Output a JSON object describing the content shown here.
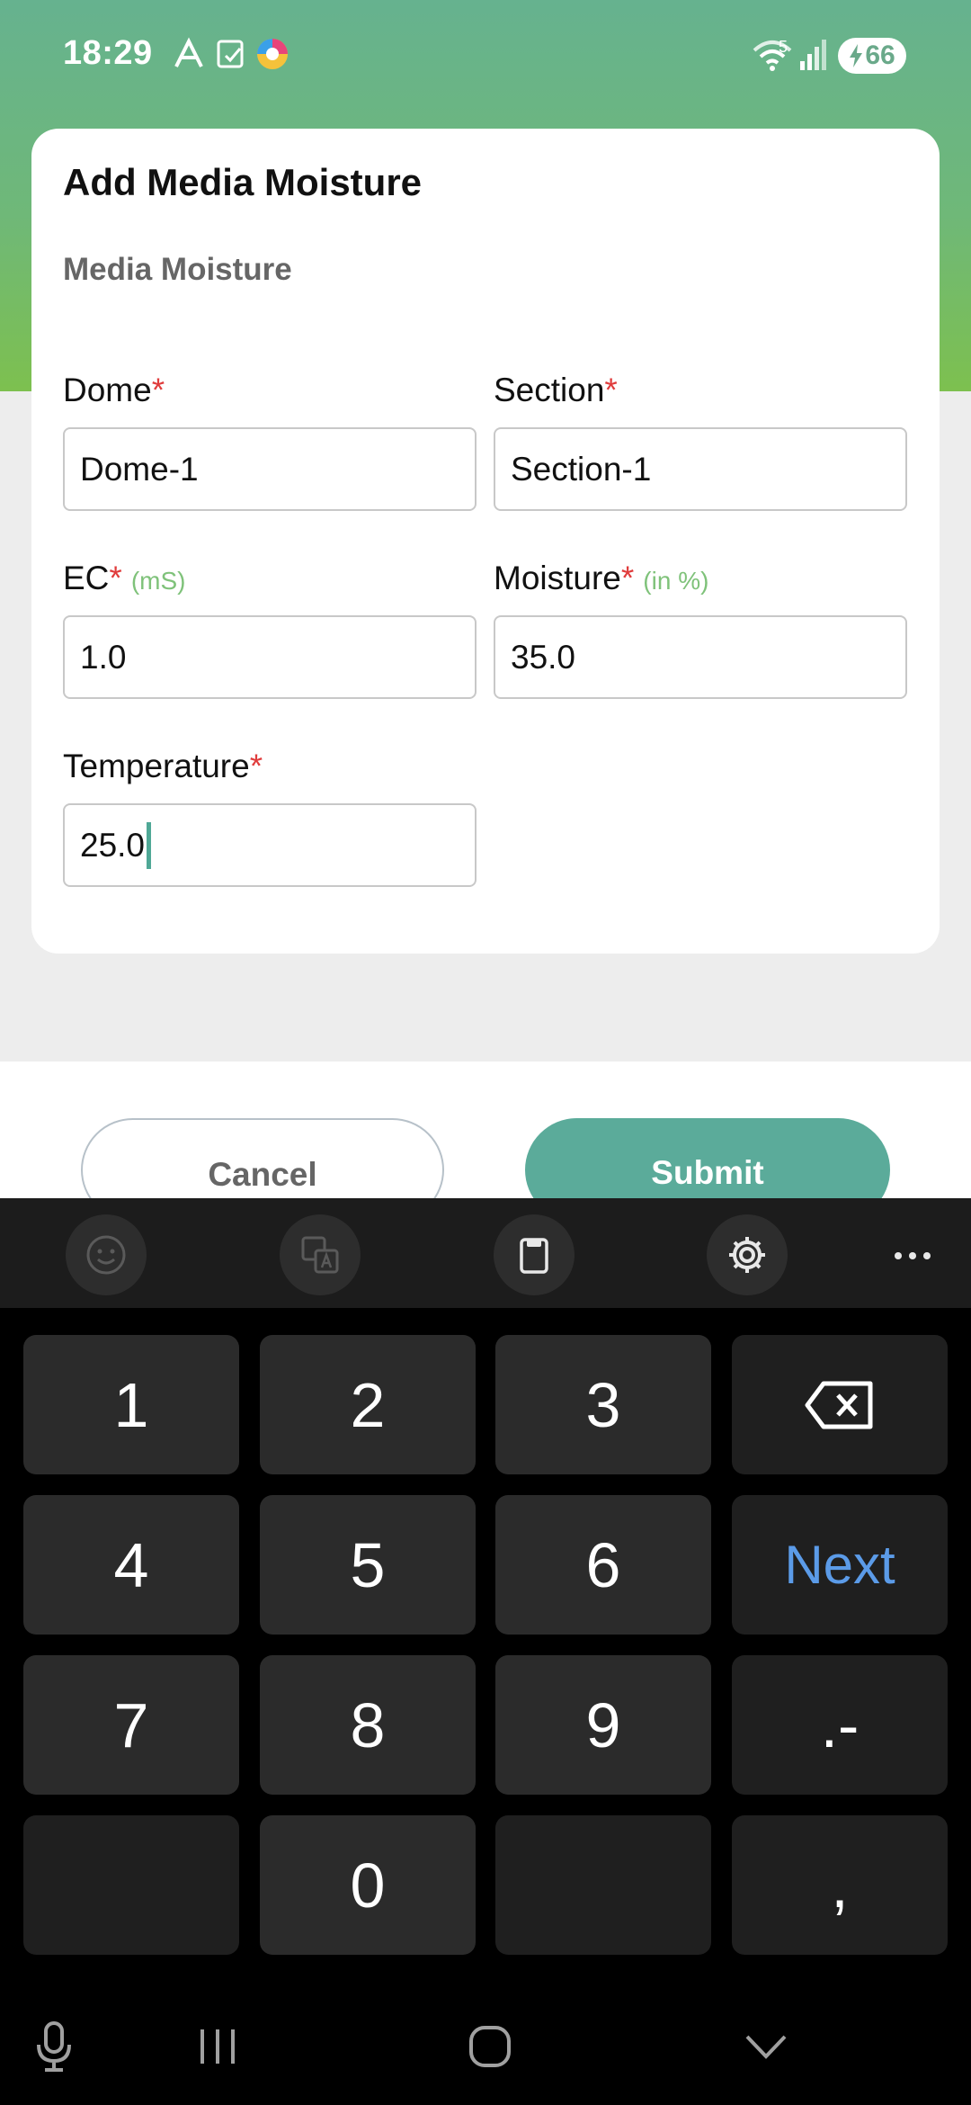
{
  "status_bar": {
    "time": "18:29",
    "battery": "66",
    "wifi_badge": "5"
  },
  "dialog": {
    "title": "Add Media Moisture",
    "subtitle": "Media Moisture",
    "required_mark": "*",
    "fields": {
      "dome": {
        "label": "Dome",
        "value": "Dome-1"
      },
      "section": {
        "label": "Section",
        "value": "Section-1"
      },
      "ec": {
        "label": "EC",
        "unit": "(mS)",
        "value": "1.0"
      },
      "moisture": {
        "label": "Moisture",
        "unit": "(in %)",
        "value": "35.0"
      },
      "temperature": {
        "label": "Temperature",
        "value": "25.0"
      }
    }
  },
  "actions": {
    "cancel": "Cancel",
    "submit": "Submit"
  },
  "keyboard": {
    "toolbar_icons": [
      "emoji-icon",
      "translate-icon",
      "clipboard-icon",
      "settings-icon",
      "more-icon"
    ],
    "keys": {
      "k1": "1",
      "k2": "2",
      "k3": "3",
      "k4": "4",
      "k5": "5",
      "k6": "6",
      "k7": "7",
      "k8": "8",
      "k9": "9",
      "k0": "0",
      "next": "Next",
      "dot_minus": ".-",
      "comma": ","
    }
  },
  "colors": {
    "header_top": "#66b28f",
    "header_bottom": "#7dc04f",
    "required": "#e03c3c",
    "unit": "#7fc27a",
    "submit": "#5bab9a",
    "next_key": "#5b9be8"
  }
}
